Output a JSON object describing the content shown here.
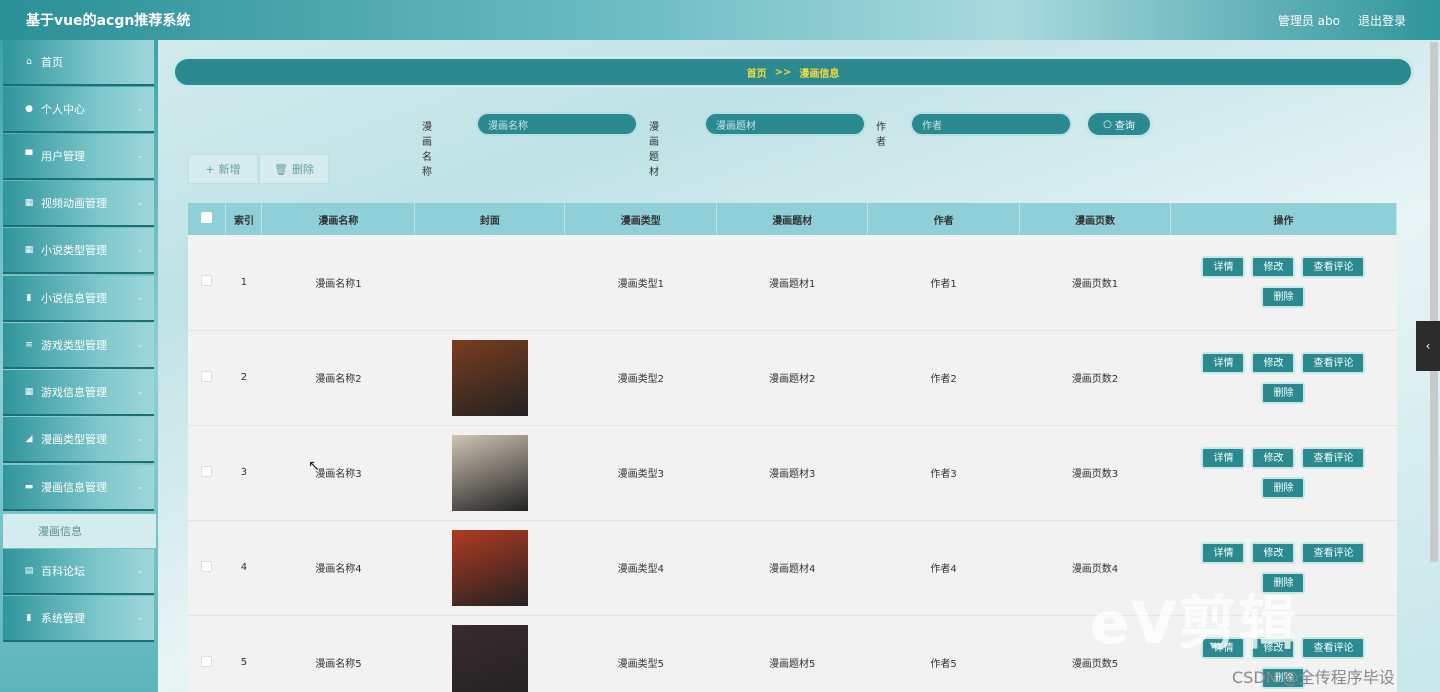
{
  "header": {
    "title": "基于vue的acgn推荐系统",
    "user": "管理员 abo",
    "logout": "退出登录"
  },
  "sidebar": {
    "items": [
      {
        "label": "首页",
        "icon": "home-icon",
        "glyph": "⌂",
        "chevron": false
      },
      {
        "label": "个人中心",
        "icon": "user-icon",
        "glyph": "●",
        "chevron": true
      },
      {
        "label": "用户管理",
        "icon": "monitor-icon",
        "glyph": "▀",
        "chevron": true
      },
      {
        "label": "视频动画管理",
        "icon": "grid-icon",
        "glyph": "▦",
        "chevron": true
      },
      {
        "label": "小说类型管理",
        "icon": "grid-icon",
        "glyph": "▦",
        "chevron": true
      },
      {
        "label": "小说信息管理",
        "icon": "clipboard-icon",
        "glyph": "▮",
        "chevron": true
      },
      {
        "label": "游戏类型管理",
        "icon": "list-icon",
        "glyph": "≡",
        "chevron": true
      },
      {
        "label": "游戏信息管理",
        "icon": "grid-icon",
        "glyph": "▦",
        "chevron": true
      },
      {
        "label": "漫画类型管理",
        "icon": "send-icon",
        "glyph": "◢",
        "chevron": true
      },
      {
        "label": "漫画信息管理",
        "icon": "book-icon",
        "glyph": "▬",
        "chevron": true
      },
      {
        "label": "百科论坛",
        "icon": "forum-icon",
        "glyph": "▤",
        "chevron": true
      },
      {
        "label": "系统管理",
        "icon": "bar-chart-icon",
        "glyph": "▮",
        "chevron": true
      }
    ],
    "active_sub": "漫画信息"
  },
  "breadcrumb": {
    "home": "首页",
    "sep": ">>",
    "current": "漫画信息"
  },
  "search": {
    "name_label": "漫画名称",
    "name_placeholder": "漫画名称",
    "subject_label": "漫画题材",
    "subject_placeholder": "漫画题材",
    "author_label": "作者",
    "author_placeholder": "作者",
    "button": "查询"
  },
  "actions": {
    "add": "新增",
    "delete": "删除"
  },
  "table": {
    "headers": [
      "索引",
      "漫画名称",
      "封面",
      "漫画类型",
      "漫画题材",
      "作者",
      "漫画页数",
      "操作"
    ],
    "ops": {
      "detail": "详情",
      "edit": "修改",
      "comments": "查看评论",
      "delete": "删除"
    },
    "rows": [
      {
        "index": "1",
        "name": "漫画名称1",
        "cover": null,
        "type": "漫画类型1",
        "subject": "漫画题材1",
        "author": "作者1",
        "pages": "漫画页数1"
      },
      {
        "index": "2",
        "name": "漫画名称2",
        "cover": "#7a3d1f",
        "type": "漫画类型2",
        "subject": "漫画题材2",
        "author": "作者2",
        "pages": "漫画页数2"
      },
      {
        "index": "3",
        "name": "漫画名称3",
        "cover": "#cfc4b4",
        "type": "漫画类型3",
        "subject": "漫画题材3",
        "author": "作者3",
        "pages": "漫画页数3"
      },
      {
        "index": "4",
        "name": "漫画名称4",
        "cover": "#b23a22",
        "type": "漫画类型4",
        "subject": "漫画题材4",
        "author": "作者4",
        "pages": "漫画页数4"
      },
      {
        "index": "5",
        "name": "漫画名称5",
        "cover": "#3a2a30",
        "type": "漫画类型5",
        "subject": "漫画题材5",
        "author": "作者5",
        "pages": "漫画页数5"
      }
    ]
  },
  "overlay": {
    "watermark": "CSDN @全传程序毕设",
    "logo": "eV剪辑"
  }
}
